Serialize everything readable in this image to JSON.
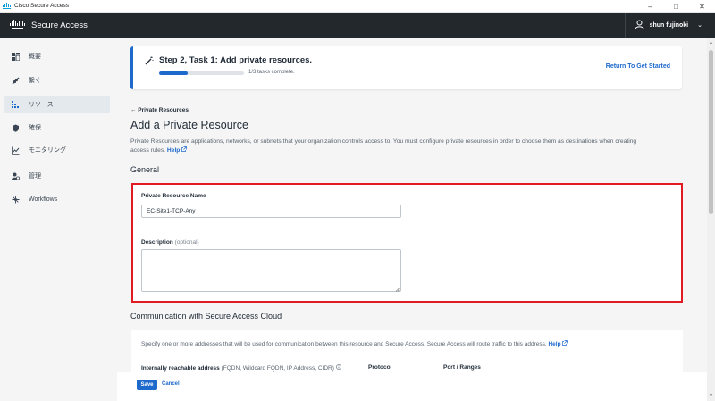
{
  "window": {
    "title": "Cisco Secure Access",
    "controls": [
      "–",
      "□",
      "✕"
    ]
  },
  "header": {
    "product": "Secure Access",
    "user": "shun fujinoki"
  },
  "sidebar": {
    "items": [
      {
        "label": "概要",
        "icon": "overview-icon"
      },
      {
        "label": "繋ぐ",
        "icon": "connect-icon"
      },
      {
        "label": "リソース",
        "icon": "resources-icon",
        "active": true
      },
      {
        "label": "確保",
        "icon": "secure-icon"
      },
      {
        "label": "モニタリング",
        "icon": "monitoring-icon"
      },
      {
        "label": "管理",
        "icon": "admin-icon"
      },
      {
        "label": "Workflows",
        "icon": "workflows-icon"
      }
    ]
  },
  "task": {
    "title": "Step 2, Task 1: Add private resources.",
    "progress_text": "1/3 tasks complete.",
    "progress_fraction": 0.333,
    "return_link": "Return To Get Started"
  },
  "page": {
    "breadcrumb": "← Private Resources",
    "title": "Add a Private Resource",
    "description_line1": "Private Resources are applications, networks, or subnets that your organization controls access to. You must configure private resources in order to choose them as destinations when creating",
    "description_line2": "access rules.",
    "help": "Help"
  },
  "general": {
    "heading": "General",
    "name_label": "Private Resource Name",
    "name_value": "EC-Site1-TCP-Any",
    "description_label": "Description",
    "description_optional": "(optional)",
    "description_value": ""
  },
  "communication": {
    "heading": "Communication with Secure Access Cloud",
    "text": "Specify one or more addresses that will be used for communication between this resource and Secure Access. Secure Access will route traffic to this address.",
    "help": "Help",
    "col_address": "Internally reachable address",
    "col_address_hint": "(FQDN, Wildcard FQDN, IP Address, CIDR)",
    "col_protocol": "Protocol",
    "col_ports": "Port / Ranges"
  },
  "footer": {
    "save": "Save",
    "cancel": "Cancel"
  },
  "colors": {
    "accent": "#1d69cc",
    "highlight": "#e11b22",
    "header_bg": "#23282d"
  }
}
